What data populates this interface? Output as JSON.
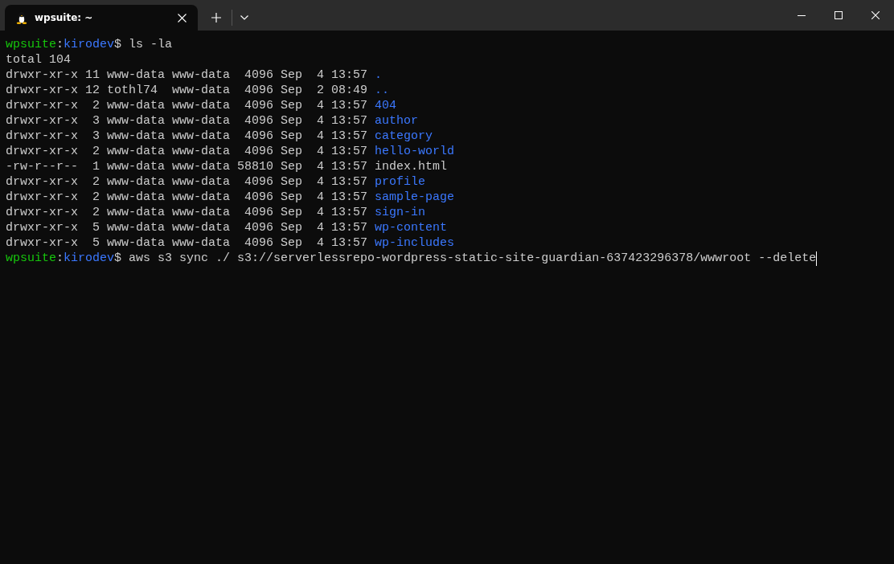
{
  "tabs": [
    {
      "title": "wpsuite: ~",
      "selected": true
    }
  ],
  "lines": [
    {
      "kind": "prompt",
      "user": "wpsuite",
      "separator": ":",
      "path": "kirodev",
      "symbol": "$",
      "command": "ls -la",
      "cursor": false
    },
    {
      "kind": "output",
      "text": "total 104"
    },
    {
      "kind": "entry",
      "details": "drwxr-xr-x 11 www-data www-data  4096 Sep  4 13:57",
      "name": ".",
      "directory": true
    },
    {
      "kind": "entry",
      "details": "drwxr-xr-x 12 tothl74  www-data  4096 Sep  2 08:49",
      "name": "..",
      "directory": true
    },
    {
      "kind": "entry",
      "details": "drwxr-xr-x  2 www-data www-data  4096 Sep  4 13:57",
      "name": "404",
      "directory": true
    },
    {
      "kind": "entry",
      "details": "drwxr-xr-x  3 www-data www-data  4096 Sep  4 13:57",
      "name": "author",
      "directory": true
    },
    {
      "kind": "entry",
      "details": "drwxr-xr-x  3 www-data www-data  4096 Sep  4 13:57",
      "name": "category",
      "directory": true
    },
    {
      "kind": "entry",
      "details": "drwxr-xr-x  2 www-data www-data  4096 Sep  4 13:57",
      "name": "hello-world",
      "directory": true
    },
    {
      "kind": "entry",
      "details": "-rw-r--r--  1 www-data www-data 58810 Sep  4 13:57",
      "name": "index.html",
      "directory": false
    },
    {
      "kind": "entry",
      "details": "drwxr-xr-x  2 www-data www-data  4096 Sep  4 13:57",
      "name": "profile",
      "directory": true
    },
    {
      "kind": "entry",
      "details": "drwxr-xr-x  2 www-data www-data  4096 Sep  4 13:57",
      "name": "sample-page",
      "directory": true
    },
    {
      "kind": "entry",
      "details": "drwxr-xr-x  2 www-data www-data  4096 Sep  4 13:57",
      "name": "sign-in",
      "directory": true
    },
    {
      "kind": "entry",
      "details": "drwxr-xr-x  5 www-data www-data  4096 Sep  4 13:57",
      "name": "wp-content",
      "directory": true
    },
    {
      "kind": "entry",
      "details": "drwxr-xr-x  5 www-data www-data  4096 Sep  4 13:57",
      "name": "wp-includes",
      "directory": true
    },
    {
      "kind": "prompt",
      "user": "wpsuite",
      "separator": ":",
      "path": "kirodev",
      "symbol": "$",
      "command": "aws s3 sync ./ s3://serverlessrepo-wordpress-static-site-guardian-637423296378/wwwroot --delete",
      "cursor": true
    }
  ]
}
